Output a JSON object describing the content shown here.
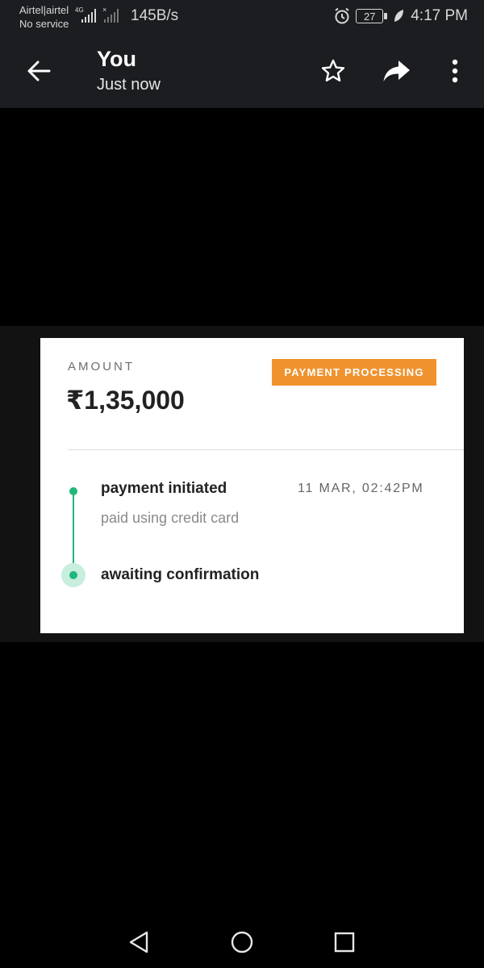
{
  "status_bar": {
    "carrier_line1": "Airtel|airtel",
    "carrier_line2": "No service",
    "network_type": "4G",
    "speed": "145B/s",
    "battery": "27",
    "time": "4:17 PM"
  },
  "app_bar": {
    "title": "You",
    "subtitle": "Just now",
    "icons": [
      "back-arrow-icon",
      "star-icon",
      "share-icon",
      "more-vert-icon"
    ]
  },
  "card": {
    "amount_label": "AMOUNT",
    "amount_value": "₹1,35,000",
    "status_badge": "PAYMENT PROCESSING",
    "steps": [
      {
        "title": "payment initiated",
        "subtitle": "paid using credit card",
        "time": "11 MAR, 02:42PM"
      },
      {
        "title": "awaiting confirmation"
      }
    ]
  },
  "colors": {
    "badge": "#f0932f",
    "timeline": "#1fb87a",
    "appbar_bg": "#1b1d20"
  },
  "nav_bar": {
    "icons": [
      "nav-back-icon",
      "nav-home-icon",
      "nav-recents-icon"
    ]
  }
}
